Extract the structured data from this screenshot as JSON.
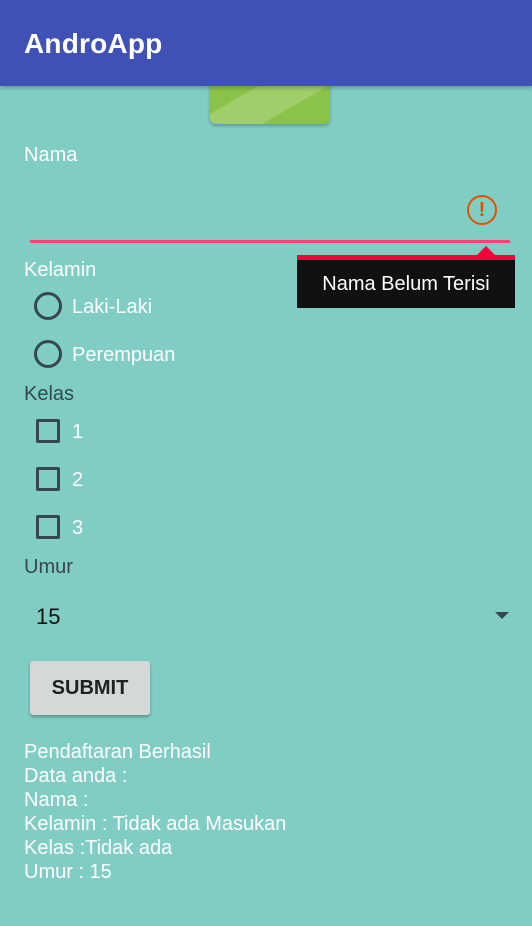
{
  "app": {
    "title": "AndroApp",
    "colors": {
      "appbar": "#3f51b5",
      "background": "#80cdc4",
      "error": "#f44377",
      "header_image": "#8bc34a"
    }
  },
  "form": {
    "name": {
      "label": "Nama",
      "value": "",
      "error_icon": "alert-circle-icon",
      "error_message": "Nama Belum Terisi"
    },
    "gender": {
      "label": "Kelamin",
      "options": [
        "Laki-Laki",
        "Perempuan"
      ],
      "selected": null
    },
    "class": {
      "label": "Kelas",
      "options": [
        "1",
        "2",
        "3"
      ],
      "checked": []
    },
    "age": {
      "label": "Umur",
      "selected": "15",
      "icon": "dropdown-triangle-icon"
    },
    "submit_label": "SUBMIT"
  },
  "result": {
    "lines": [
      "Pendaftaran Berhasil",
      "Data anda :",
      "Nama :",
      "Kelamin : Tidak ada Masukan",
      "Kelas :Tidak ada",
      "Umur : 15"
    ]
  }
}
